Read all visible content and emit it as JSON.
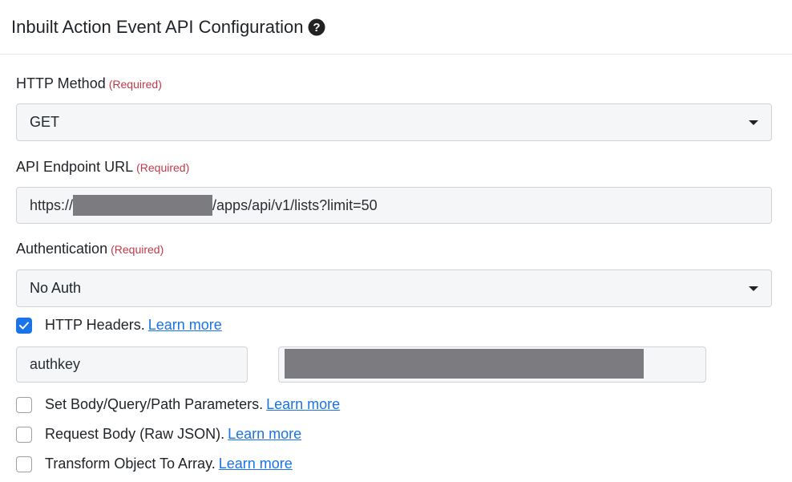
{
  "header": {
    "title": "Inbuilt Action Event API Configuration",
    "help_icon": "question-circle-icon"
  },
  "required_text": "(Required)",
  "http_method": {
    "label": "HTTP Method",
    "value": "GET"
  },
  "api_endpoint": {
    "label": "API Endpoint URL",
    "prefix": "https://",
    "suffix": "/apps/api/v1/lists?limit=50"
  },
  "authentication": {
    "label": "Authentication",
    "value": "No Auth"
  },
  "http_headers": {
    "label": "HTTP Headers.",
    "link": "Learn more",
    "checked": true,
    "key": "authkey"
  },
  "options": [
    {
      "label": "Set Body/Query/Path Parameters.",
      "link": "Learn more",
      "checked": false
    },
    {
      "label": "Request Body (Raw JSON).",
      "link": "Learn more",
      "checked": false
    },
    {
      "label": "Transform Object To Array.",
      "link": "Learn more",
      "checked": false
    }
  ],
  "colors": {
    "accent": "#1a73e8",
    "required": "#c13a4a",
    "field_bg": "#f4f6f8"
  }
}
